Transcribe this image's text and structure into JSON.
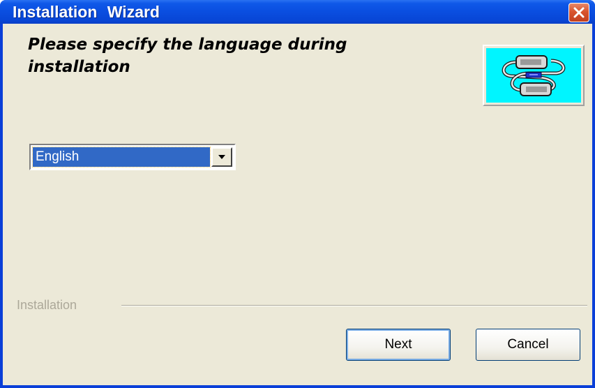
{
  "window": {
    "title": "Installation  Wizard",
    "close_icon": "close-icon"
  },
  "main": {
    "heading": "Please specify the language during installation",
    "logo_icon": "usb-cable-icon",
    "language_select": {
      "selected": "English",
      "dropdown_icon": "chevron-down-icon"
    }
  },
  "footer": {
    "section_label": "Installation",
    "next_label": "Next",
    "cancel_label": "Cancel"
  },
  "colors": {
    "titlebar": "#0a4ee0",
    "client_bg": "#ece9d8",
    "selection": "#3169c6",
    "logo_bg": "#00f5ff",
    "close_button": "#d9542e"
  }
}
